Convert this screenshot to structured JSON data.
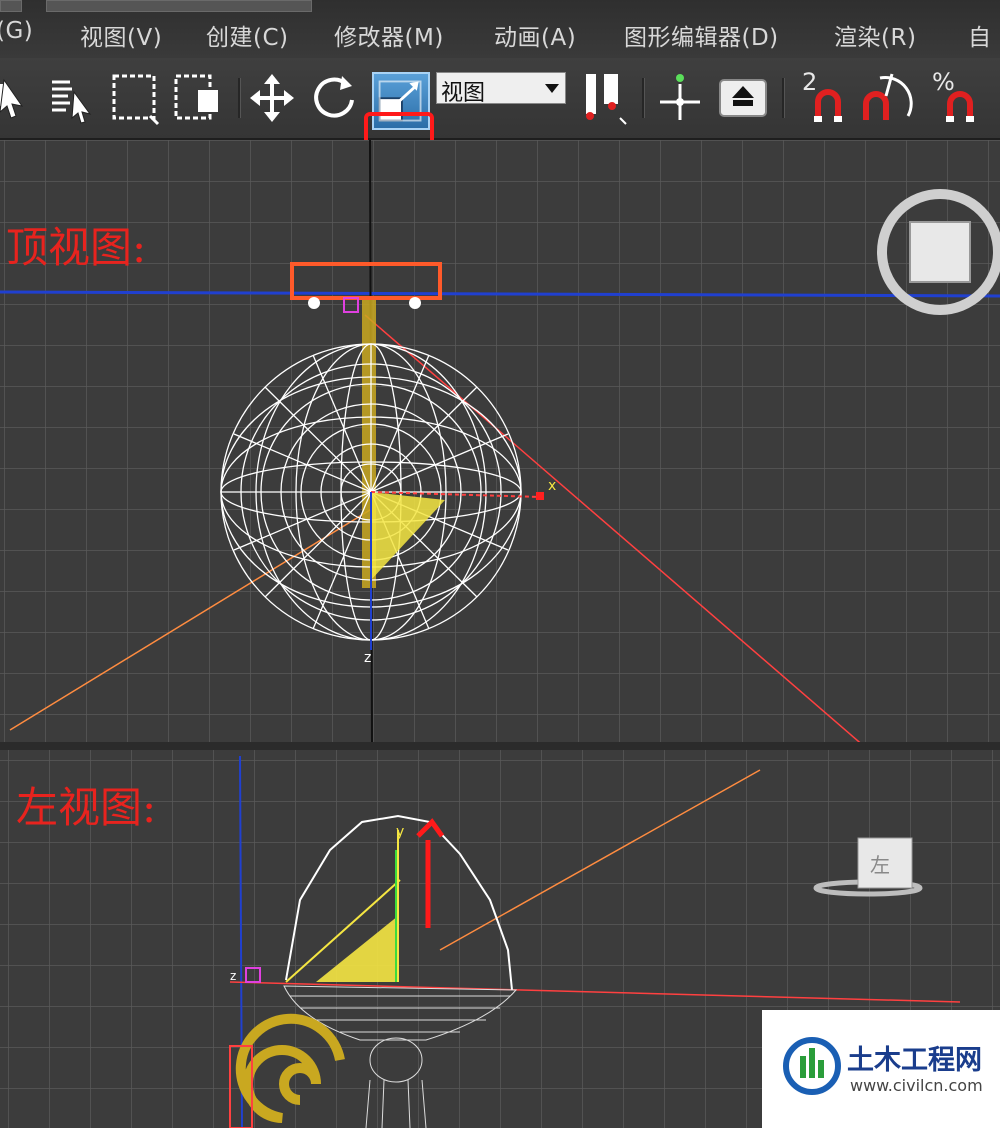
{
  "menubar": {
    "items": [
      {
        "label": "(G)"
      },
      {
        "label": "视图(V)"
      },
      {
        "label": "创建(C)"
      },
      {
        "label": "修改器(M)"
      },
      {
        "label": "动画(A)"
      },
      {
        "label": "图形编辑器(D)"
      },
      {
        "label": "渲染(R)"
      },
      {
        "label": "自"
      }
    ]
  },
  "toolbar": {
    "icons": [
      "select-object-icon",
      "select-by-name-icon",
      "rectangular-selection-icon",
      "window-crossing-icon",
      "select-and-move-icon",
      "select-and-rotate-icon",
      "select-and-scale-icon",
      "reference-coordinate-dropdown",
      "pivot-center-icon",
      "select-manipulate-icon",
      "keyboard-shortcut-override-icon",
      "snap-2d-icon",
      "angle-snap-icon",
      "percent-snap-icon"
    ],
    "reference_coordinate": "视图",
    "snap_toggle": "2",
    "percent_snap": "%"
  },
  "viewports": {
    "top": {
      "annotation": "顶视图:",
      "axis_x_label": "x",
      "axis_z_label": "z"
    },
    "left": {
      "annotation": "左视图:",
      "axis_y_label": "y",
      "axis_z_label": "z",
      "viewcube_label": "左"
    }
  },
  "colors": {
    "highlight_box": "#ff1a1a",
    "wireframe": "#ffffff",
    "gizmo_yellow": "#f5e642",
    "axis_red": "#ff4040",
    "axis_blue": "#2040d0",
    "light_orange": "#ff8c40"
  },
  "watermark": {
    "title": "土木工程网",
    "url": "www.civilcn.com"
  }
}
